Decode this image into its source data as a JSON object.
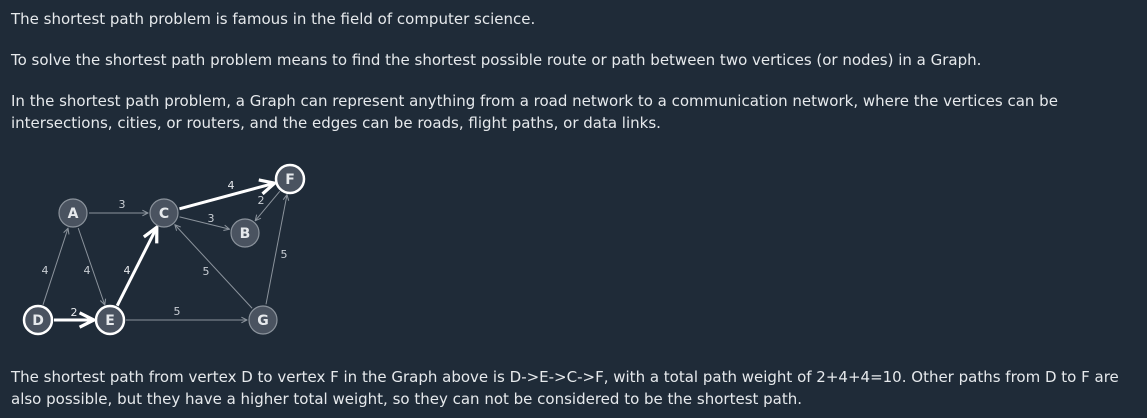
{
  "text": {
    "p1": "The shortest path problem is famous in the field of computer science.",
    "p2": "To solve the shortest path problem means to find the shortest possible route or path between two vertices (or nodes) in a Graph.",
    "p3": "In the shortest path problem, a Graph can represent anything from a road network to a communication network, where the vertices can be intersections, cities, or routers, and the edges can be roads, flight paths, or data links.",
    "p4": "The shortest path from vertex D to vertex F in the Graph above is D->E->C->F, with a total path weight of 2+4+4=10. Other paths from D to F are also possible, but they have a higher total weight, so they can not be considered to be the shortest path."
  },
  "graph": {
    "node_fill": "#4a5360",
    "node_stroke": "#8b939c",
    "highlight_color": "#ffffff",
    "edge_color": "#8b939c",
    "nodes": [
      {
        "id": "A",
        "label": "A"
      },
      {
        "id": "B",
        "label": "B"
      },
      {
        "id": "C",
        "label": "C"
      },
      {
        "id": "D",
        "label": "D",
        "highlight": true
      },
      {
        "id": "E",
        "label": "E",
        "highlight": true
      },
      {
        "id": "F",
        "label": "F",
        "highlight": true
      },
      {
        "id": "G",
        "label": "G"
      }
    ],
    "edges": [
      {
        "from": "D",
        "to": "A",
        "weight": "4"
      },
      {
        "from": "A",
        "to": "E",
        "weight": "4"
      },
      {
        "from": "A",
        "to": "C",
        "weight": "3"
      },
      {
        "from": "D",
        "to": "E",
        "weight": "2",
        "path": true
      },
      {
        "from": "E",
        "to": "C",
        "weight": "4",
        "path": true
      },
      {
        "from": "C",
        "to": "F",
        "weight": "4",
        "path": true
      },
      {
        "from": "C",
        "to": "B",
        "weight": "3"
      },
      {
        "from": "F",
        "to": "B",
        "weight": "2"
      },
      {
        "from": "G",
        "to": "F",
        "weight": "5"
      },
      {
        "from": "G",
        "to": "C",
        "weight": "5"
      },
      {
        "from": "E",
        "to": "G",
        "weight": "5"
      }
    ]
  }
}
